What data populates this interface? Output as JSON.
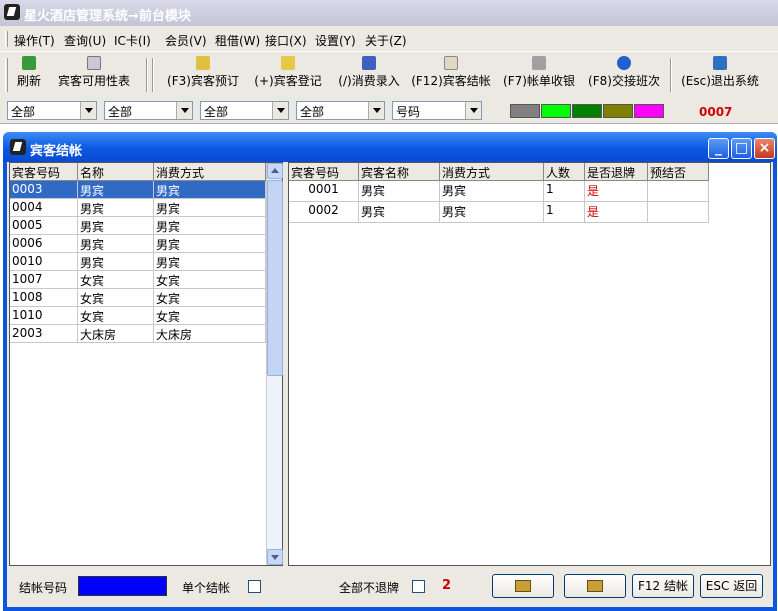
{
  "app": {
    "title": "星火酒店管理系统→前台模块"
  },
  "menu": {
    "items": [
      "操作(T)",
      "查询(U)",
      "IC卡(I)",
      "会员(V)",
      "租借(W)",
      "接口(X)",
      "设置(Y)",
      "关于(Z)"
    ]
  },
  "toolbar": {
    "refresh": "刷新",
    "availability": "宾客可用性表",
    "reserve": "(F3)宾客预订",
    "checkin": "(+)宾客登记",
    "consume": "(/)消费录入",
    "checkout": "(F12)宾客结帐",
    "cashier": "(F7)帐单收银",
    "shift": "(F8)交接班次",
    "exit": "(Esc)退出系统"
  },
  "filters": {
    "combos": [
      "全部",
      "全部",
      "全部",
      "全部",
      "号码"
    ],
    "swatches": [
      "#808080",
      "#00ff00",
      "#008000",
      "#808000",
      "#ff00ff"
    ],
    "code": "0007"
  },
  "dialog": {
    "title": "宾客结帐"
  },
  "left_table": {
    "headers": [
      "宾客号码",
      "名称",
      "消费方式"
    ],
    "rows": [
      [
        "0003",
        "男宾",
        "男宾"
      ],
      [
        "0004",
        "男宾",
        "男宾"
      ],
      [
        "0005",
        "男宾",
        "男宾"
      ],
      [
        "0006",
        "男宾",
        "男宾"
      ],
      [
        "0010",
        "男宾",
        "男宾"
      ],
      [
        "1007",
        "女宾",
        "女宾"
      ],
      [
        "1008",
        "女宾",
        "女宾"
      ],
      [
        "1010",
        "女宾",
        "女宾"
      ],
      [
        "2003",
        "大床房",
        "大床房"
      ]
    ]
  },
  "right_table": {
    "headers": [
      "宾客号码",
      "宾客名称",
      "消费方式",
      "人数",
      "是否退牌",
      "预结否"
    ],
    "rows": [
      [
        "0001",
        "男宾",
        "男宾",
        "1",
        "是",
        ""
      ],
      [
        "0002",
        "男宾",
        "男宾",
        "1",
        "是",
        ""
      ]
    ]
  },
  "footer": {
    "checkout_no_label": "结帐号码",
    "single_label": "单个结帐",
    "all_no_return_label": "全部不退牌",
    "count": "2",
    "f12_label": "F12 结帐",
    "esc_label": "ESC 返回"
  },
  "colors": {
    "selected": "#316ac5",
    "accent": "#0b55e0",
    "red": "#d00000"
  }
}
